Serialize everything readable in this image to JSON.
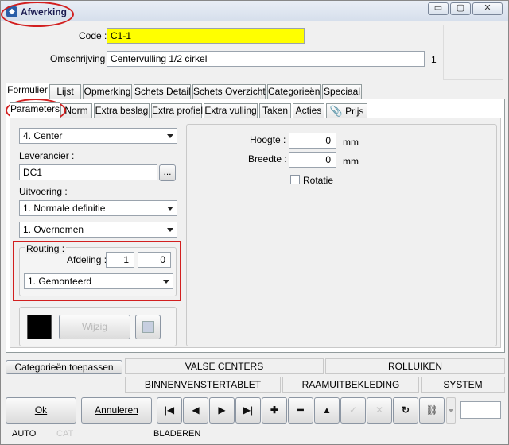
{
  "window": {
    "title": "Afwerking",
    "controls": [
      "▭",
      "▢",
      "✕"
    ]
  },
  "header": {
    "code_label": "Code :",
    "code_value": "C1-1",
    "desc_label": "Omschrijving :",
    "desc_value": "Centervulling 1/2 cirkel",
    "desc_count": "1"
  },
  "main_tabs": [
    "Formulier",
    "Lijst",
    "Opmerking",
    "Schets Detail",
    "Schets Overzicht",
    "Categorieën",
    "Speciaal"
  ],
  "sub_tabs": [
    "Parameters",
    "Norm",
    "Extra beslag",
    "Extra profiel",
    "Extra vulling",
    "Taken",
    "Acties",
    "Prijs"
  ],
  "left": {
    "type_value": "4.  Center",
    "supplier_label": "Leverancier :",
    "supplier_value": "DC1",
    "supplier_button": "...",
    "execution_label": "Uitvoering :",
    "execution_value": "1.  Normale definitie",
    "take_over_value": "1.  Overnemen",
    "routing_label": "Routing :",
    "department_label": "Afdeling :",
    "department_value1": "1",
    "department_value2": "0",
    "routing_value": "1.  Gemonteerd",
    "change_button": "Wijzig",
    "color_swatch": "#000000"
  },
  "right": {
    "height_label": "Hoogte :",
    "height_value": "0",
    "height_unit": "mm",
    "width_label": "Breedte :",
    "width_value": "0",
    "width_unit": "mm",
    "rotation_label": "Rotatie"
  },
  "category_strip": {
    "apply_button": "Categorieën toepassen",
    "row1": [
      "VALSE CENTERS",
      "ROLLUIKEN"
    ],
    "row2": [
      "BINNENVENSTERTABLET",
      "RAAMUITBEKLEDING",
      "SYSTEM"
    ]
  },
  "actions": {
    "ok": "Ok",
    "cancel": "Annuleren",
    "nav": [
      "|◀",
      "◀",
      "▶",
      "▶|",
      "✚",
      "━",
      "▲",
      "✓",
      "✕",
      "↻",
      "⛓"
    ]
  },
  "status": {
    "auto": "AUTO",
    "cat": "CAT",
    "mode": "BLADEREN"
  },
  "accent": {
    "highlight": "#ffff00",
    "annotation": "#d21f1f"
  }
}
